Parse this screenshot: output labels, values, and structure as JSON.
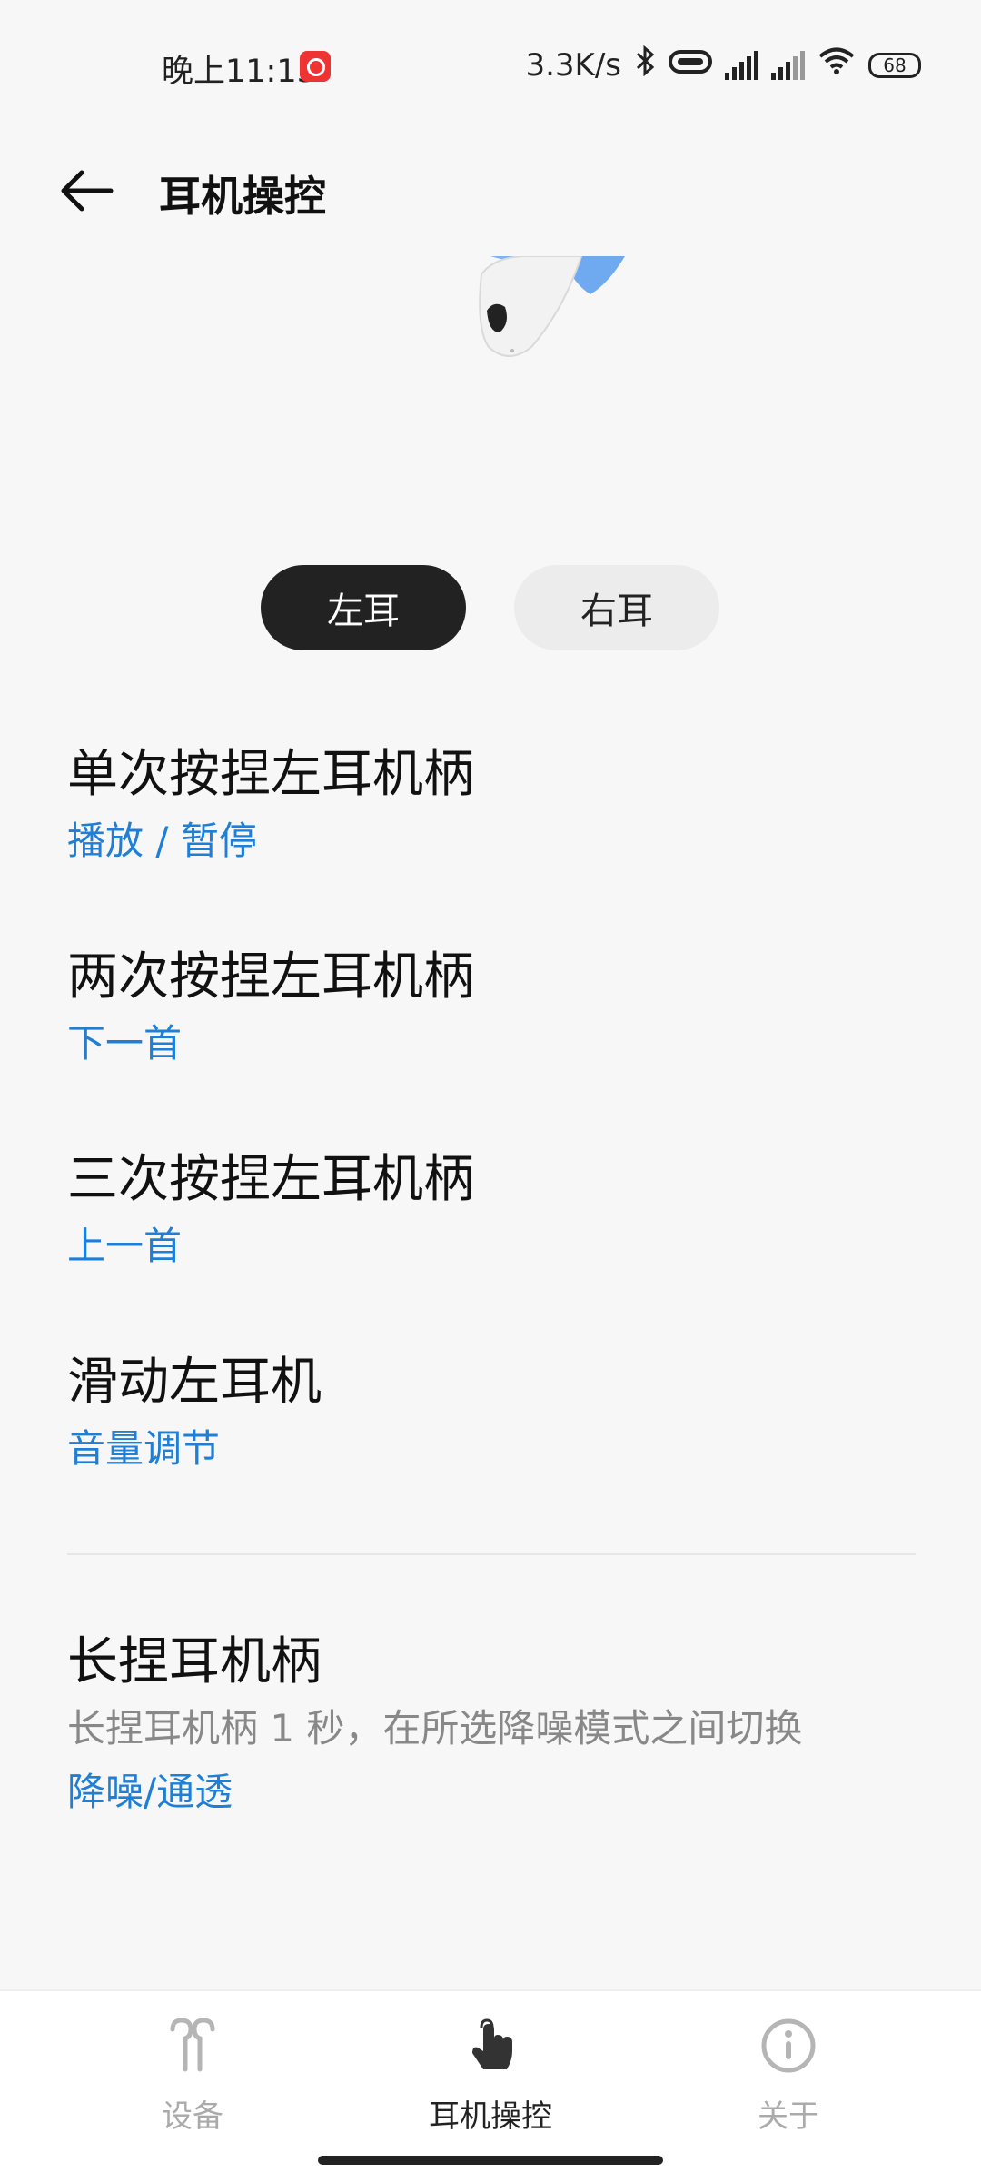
{
  "status_bar": {
    "time": "晚上11:13",
    "network_speed": "3.3K/s",
    "battery": "68",
    "icons": [
      "app-badge-icon",
      "bluetooth-icon",
      "headphone-link-icon",
      "signal-hd-icon",
      "signal-hd-icon",
      "wifi-icon",
      "battery-icon"
    ]
  },
  "header": {
    "title": "耳机操控",
    "back_icon": "back-arrow-icon"
  },
  "tabs": {
    "left": "左耳",
    "right": "右耳",
    "selected": "左耳"
  },
  "settings": [
    {
      "title": "单次按捏左耳机柄",
      "value": "播放 / 暂停"
    },
    {
      "title": "两次按捏左耳机柄",
      "value": "下一首"
    },
    {
      "title": "三次按捏左耳机柄",
      "value": "上一首"
    },
    {
      "title": "滑动左耳机",
      "value": "音量调节"
    }
  ],
  "long_press": {
    "title": "长捏耳机柄",
    "description": "长捏耳机柄 1 秒，在所选降噪模式之间切换",
    "value": "降噪/通透"
  },
  "bottom_nav": {
    "items": [
      {
        "label": "设备",
        "icon": "earbuds-icon",
        "active": false
      },
      {
        "label": "耳机操控",
        "icon": "touch-hand-icon",
        "active": true
      },
      {
        "label": "关于",
        "icon": "info-icon",
        "active": false
      }
    ]
  },
  "colors": {
    "accent": "#1f7fd6",
    "active_tab_bg": "#222222",
    "inactive_tab_bg": "#ececec",
    "page_bg": "#f7f7f7"
  }
}
